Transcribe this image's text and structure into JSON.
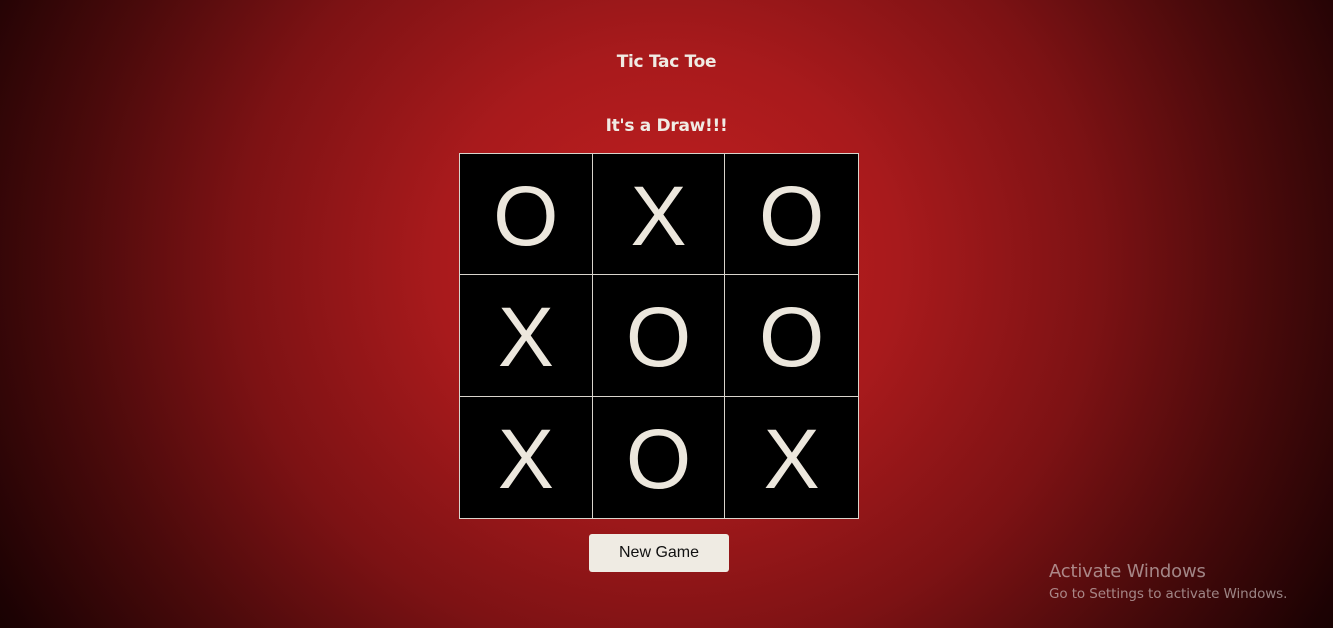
{
  "game": {
    "title": "Tic Tac Toe",
    "status": "It's a Draw!!!",
    "board": [
      [
        "O",
        "X",
        "O"
      ],
      [
        "X",
        "O",
        "O"
      ],
      [
        "X",
        "O",
        "X"
      ]
    ],
    "new_game_label": "New Game"
  },
  "watermark": {
    "title": "Activate Windows",
    "subtitle": "Go to Settings to activate Windows."
  },
  "colors": {
    "background_center": "#c21f20",
    "background_edge": "#120000",
    "board_bg": "#000000",
    "grid_line": "#d9d4cc",
    "mark": "#ece7dd",
    "button_bg": "#efebe3"
  }
}
